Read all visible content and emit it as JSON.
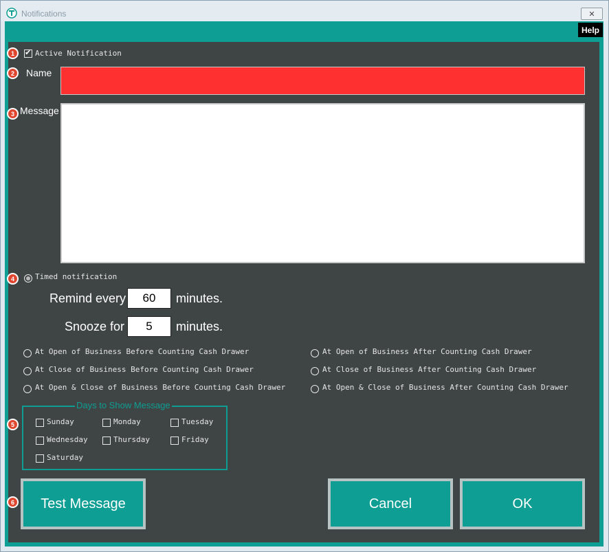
{
  "window": {
    "title": "Notifications",
    "close_symbol": "✕"
  },
  "toolbar": {
    "help_label": "Help"
  },
  "markers": [
    "1",
    "2",
    "3",
    "4",
    "5",
    "6"
  ],
  "form": {
    "active_notification_label": "Active Notification",
    "active_notification_checked": true,
    "name_label": "Name",
    "name_value": "",
    "message_label": "Message",
    "message_value": "",
    "timed_notification_label": "Timed notification",
    "remind_prefix": "Remind every",
    "remind_value": "60",
    "remind_suffix": "minutes.",
    "snooze_prefix": "Snooze for",
    "snooze_value": "5",
    "snooze_suffix": "minutes."
  },
  "schedule_options": [
    "At Open of Business Before Counting Cash Drawer",
    "At Open of Business After Counting Cash Drawer",
    "At Close of Business Before Counting Cash Drawer",
    "At Close of Business After Counting Cash Drawer",
    "At Open & Close of Business Before Counting Cash Drawer",
    "At Open & Close of Business After Counting Cash Drawer"
  ],
  "days_group": {
    "title": "Days to Show Message",
    "days": [
      "Sunday",
      "Monday",
      "Tuesday",
      "Wednesday",
      "Thursday",
      "Friday",
      "Saturday"
    ]
  },
  "buttons": {
    "test_message": "Test Message",
    "cancel": "Cancel",
    "ok": "OK"
  },
  "colors": {
    "teal": "#0e9e93",
    "panel": "#3f4444",
    "name_field": "#ff3030",
    "marker": "#e0452d"
  },
  "icons": {
    "app": "app-logo-icon",
    "close": "close-icon",
    "marker": "numbered-marker-icon"
  }
}
